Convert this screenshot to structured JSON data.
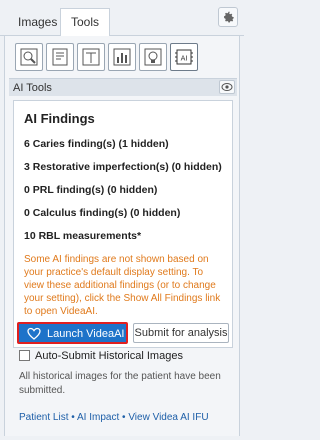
{
  "tabs": [
    {
      "label": "Images",
      "active": false
    },
    {
      "label": "Tools",
      "active": true
    }
  ],
  "icons": {
    "settings": "gear-icon",
    "visibility": "eye-icon",
    "launch": "heart-tooth-icon",
    "tool_row": [
      "tooth-search-icon",
      "report-icon",
      "measure-icon",
      "chart-icon",
      "lightbulb-icon",
      "ai-chip-icon"
    ]
  },
  "ai_tools": {
    "header": "AI Tools"
  },
  "findings": {
    "title": "AI Findings",
    "items": [
      "6 Caries finding(s) (1 hidden)",
      "3 Restorative imperfection(s) (0 hidden)",
      "0 PRL finding(s) (0 hidden)",
      "0 Calculus finding(s) (0 hidden)",
      "10 RBL measurements*"
    ],
    "note": "Some AI findings are not shown based on your practice's default display setting. To view these additional findings (or to change your setting), click the Show All Findings link to open VideaAI."
  },
  "buttons": {
    "launch": "Launch VideaAI",
    "submit": "Submit for analysis"
  },
  "auto_submit_label": "Auto-Submit Historical Images",
  "history_note": "All historical images for the patient have been submitted.",
  "footer_links": [
    "Patient List",
    "AI Impact",
    "View Videa AI IFU"
  ],
  "footer_separator": " • ",
  "colors": {
    "accent": "#1e73c9",
    "highlight_border": "#e02020",
    "note": "#e07a1c",
    "link": "#1e5fa8"
  }
}
